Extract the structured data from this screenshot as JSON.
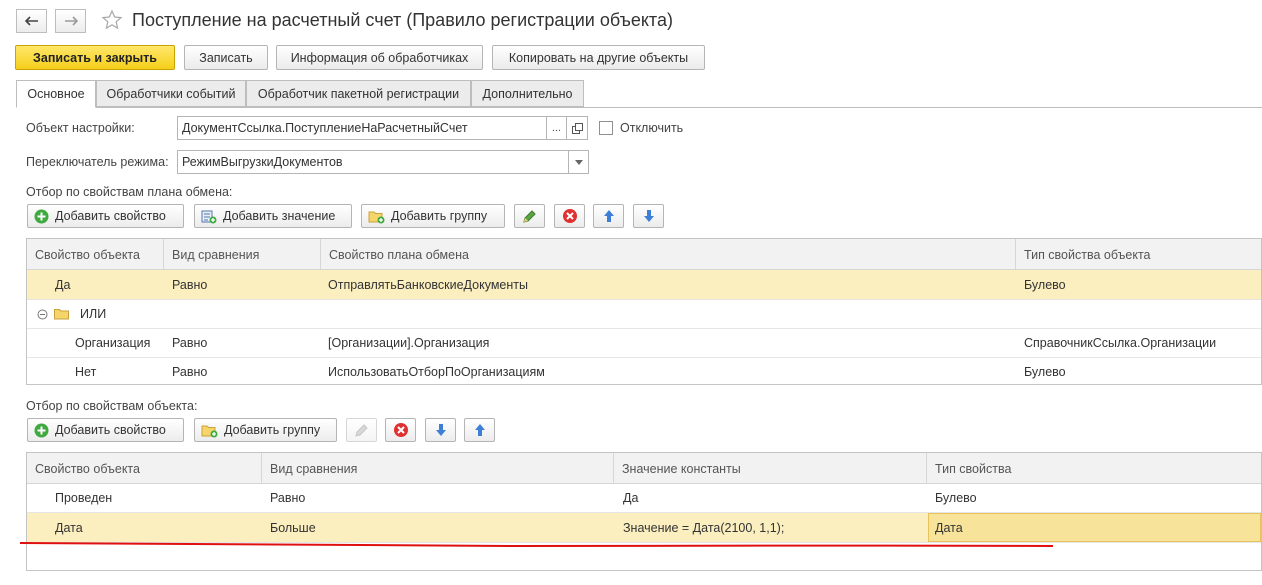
{
  "window": {
    "title": "Поступление на расчетный счет (Правило регистрации объекта)"
  },
  "toolbar": {
    "save_close": "Записать и закрыть",
    "save": "Записать",
    "handlers_info": "Информация об обработчиках",
    "copy_other": "Копировать на другие объекты"
  },
  "tabs": [
    "Основное",
    "Обработчики событий",
    "Обработчик пакетной регистрации",
    "Дополнительно"
  ],
  "form": {
    "object_label": "Объект настройки:",
    "object_value": "ДокументСсылка.ПоступлениеНаРасчетныйСчет",
    "ellipsis": "...",
    "disable_label": "Отключить",
    "disable_checked": false,
    "mode_label": "Переключатель режима:",
    "mode_value": "РежимВыгрузкиДокументов"
  },
  "exchange_filter": {
    "section_label": "Отбор по свойствам плана обмена:",
    "add_property": "Добавить свойство",
    "add_value": "Добавить значение",
    "add_group": "Добавить группу",
    "columns": [
      "Свойство объекта",
      "Вид сравнения",
      "Свойство плана обмена",
      "Тип свойства объекта"
    ],
    "rows": [
      {
        "prop": "Да",
        "cmp": "Равно",
        "plan": "ОтправлятьБанковскиеДокументы",
        "type": "Булево"
      },
      {
        "group": "ИЛИ"
      },
      {
        "prop": "Организация",
        "cmp": "Равно",
        "plan": "[Организации].Организация",
        "type": "СправочникСсылка.Организации"
      },
      {
        "prop": "Нет",
        "cmp": "Равно",
        "plan": "ИспользоватьОтборПоОрганизациям",
        "type": "Булево"
      }
    ]
  },
  "object_filter": {
    "section_label": "Отбор по свойствам объекта:",
    "add_property": "Добавить свойство",
    "add_group": "Добавить группу",
    "columns": [
      "Свойство объекта",
      "Вид сравнения",
      "Значение константы",
      "Тип свойства"
    ],
    "rows": [
      {
        "prop": "Проведен",
        "cmp": "Равно",
        "value": "Да",
        "type": "Булево"
      },
      {
        "prop": "Дата",
        "cmp": "Больше",
        "value": "Значение = Дата(2100, 1,1);",
        "type": "Дата"
      }
    ]
  },
  "colors": {
    "primary_button": "#f5cf1a",
    "selected_row": "#fbefc0",
    "annotation_line": "#e01010"
  }
}
